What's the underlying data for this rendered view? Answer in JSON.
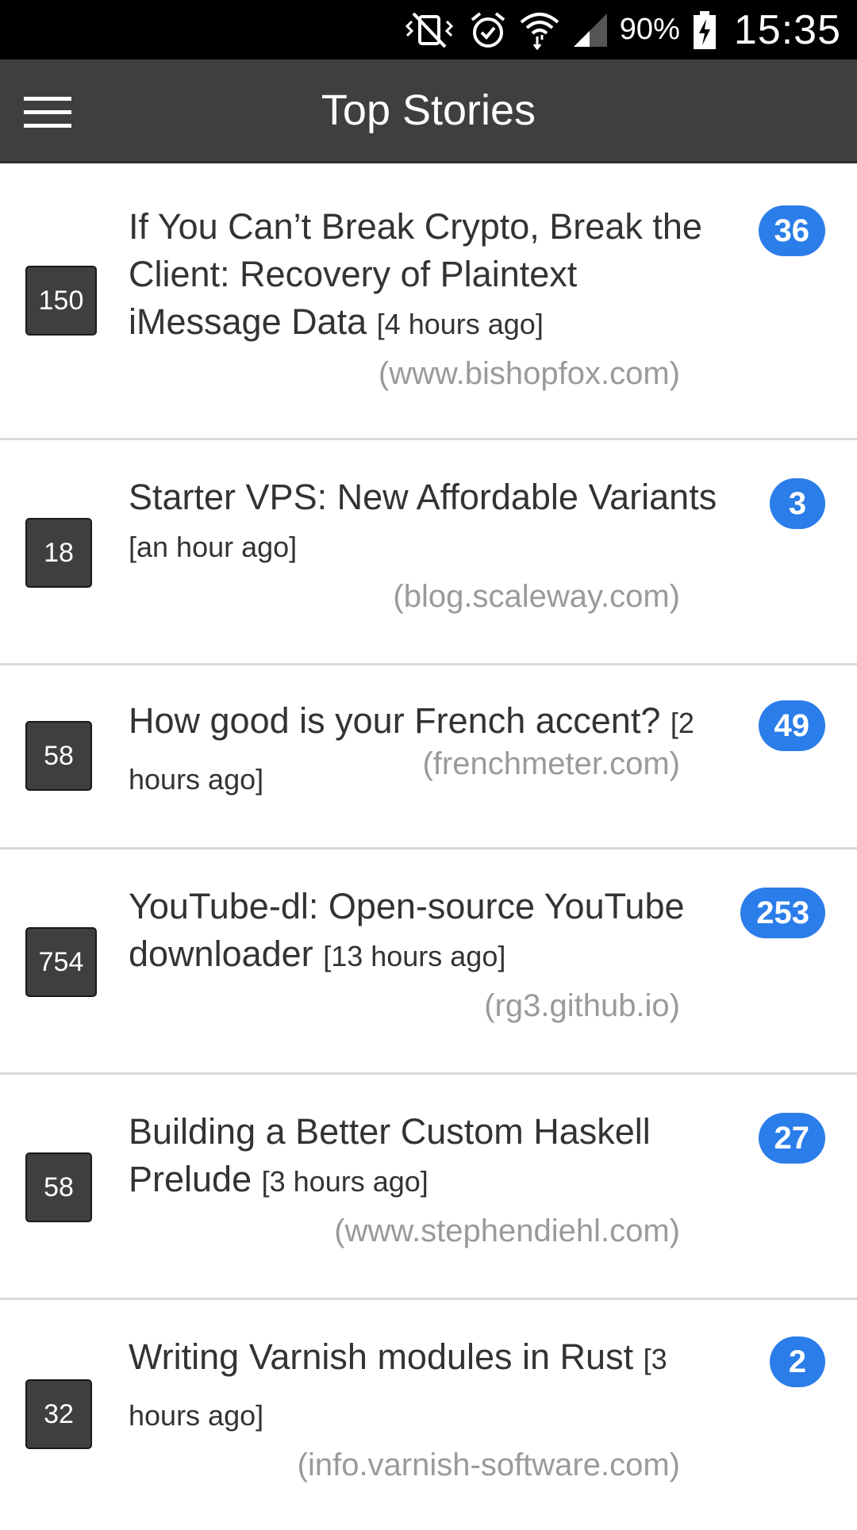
{
  "status_bar": {
    "battery_percent": "90%",
    "time": "15:35",
    "icons": [
      "vibrate-mute-icon",
      "alarm-icon",
      "wifi-icon",
      "cell-signal-icon",
      "battery-charging-icon"
    ]
  },
  "app_bar": {
    "title": "Top Stories",
    "menu_icon": "hamburger-menu-icon"
  },
  "colors": {
    "app_bar": "#3f3f3f",
    "score_box": "#3f3f3f",
    "comment_badge": "#2b7de9",
    "domain_text": "#9a9a9a"
  },
  "stories": [
    {
      "score": "150",
      "title": "If You Can’t Break Crypto, Break the Client: Recovery of Plaintext iMessage Data",
      "time": "[4 hours ago]",
      "domain": "(www.bishopfox.com)",
      "comments": "36"
    },
    {
      "score": "18",
      "title": "Starter VPS: New Affordable Variants",
      "time": "[an hour ago]",
      "domain": "(blog.scaleway.com)",
      "comments": "3"
    },
    {
      "score": "58",
      "title": "How good is your French accent?",
      "time": "[2 hours ago]",
      "domain": "(frenchmeter.com)",
      "comments": "49"
    },
    {
      "score": "754",
      "title": "YouTube-dl: Open-source YouTube downloader",
      "time": "[13 hours ago]",
      "domain": "(rg3.github.io)",
      "comments": "253"
    },
    {
      "score": "58",
      "title": "Building a Better Custom Haskell Prelude",
      "time": "[3 hours ago]",
      "domain": "(www.stephendiehl.com)",
      "comments": "27"
    },
    {
      "score": "32",
      "title": "Writing Varnish modules in Rust",
      "time": "[3 hours ago]",
      "domain": "(info.varnish-software.com)",
      "comments": "2"
    }
  ]
}
